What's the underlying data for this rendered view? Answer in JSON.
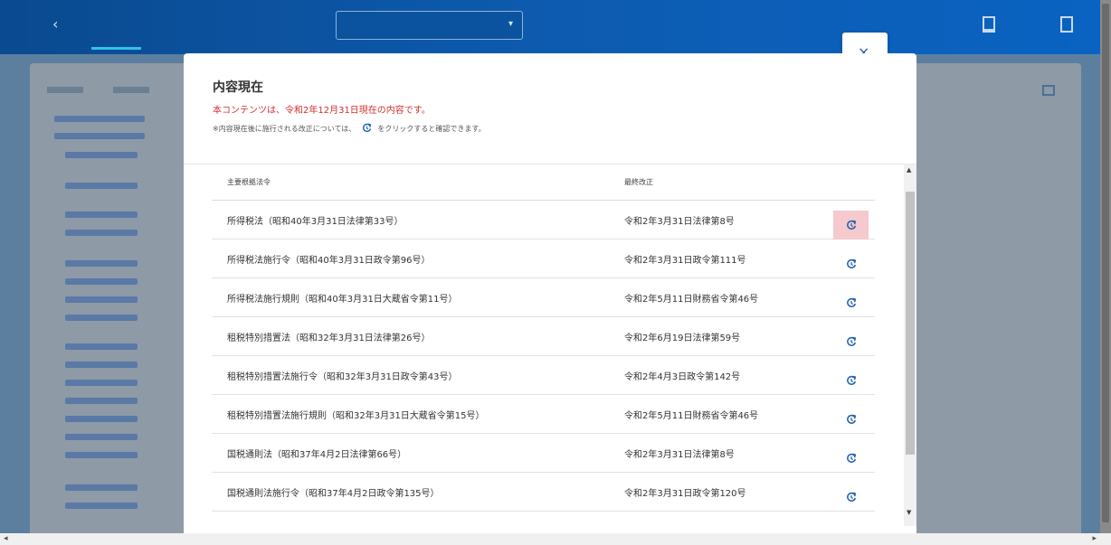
{
  "modal": {
    "title": "内容現在",
    "notice": "本コンテンツは、令和2年12月31日現在の内容です。",
    "note_before": "※内容現在後に施行される改正については、",
    "note_after": "をクリックすると確認できます。",
    "close_label": "×",
    "table": {
      "col_law": "主要根拠法令",
      "col_revision": "最終改正",
      "rows": [
        {
          "law": "所得税法（昭和40年3月31日法律第33号）",
          "revision": "令和2年3月31日法律第8号"
        },
        {
          "law": "所得税法施行令（昭和40年3月31日政令第96号）",
          "revision": "令和2年3月31日政令第111号"
        },
        {
          "law": "所得税法施行規則（昭和40年3月31日大蔵省令第11号）",
          "revision": "令和2年5月11日財務省令第46号"
        },
        {
          "law": "租税特別措置法（昭和32年3月31日法律第26号）",
          "revision": "令和2年6月19日法律第59号"
        },
        {
          "law": "租税特別措置法施行令（昭和32年3月31日政令第43号）",
          "revision": "令和2年4月3日政令第142号"
        },
        {
          "law": "租税特別措置法施行規則（昭和32年3月31日大蔵省令第15号）",
          "revision": "令和2年5月11日財務省令第46号"
        },
        {
          "law": "国税通則法（昭和37年4月2日法律第66号）",
          "revision": "令和2年3月31日法律第8号"
        },
        {
          "law": "国税通則法施行令（昭和37年4月2日政令第135号）",
          "revision": "令和2年3月31日政令第120号"
        }
      ]
    }
  },
  "icons": {
    "history": "history-icon",
    "close": "close-icon",
    "back": "back-arrow-icon"
  },
  "colors": {
    "accent": "#1f5fae",
    "notice": "#d0312d",
    "active_row_icon_bg": "#f5c9cd"
  }
}
